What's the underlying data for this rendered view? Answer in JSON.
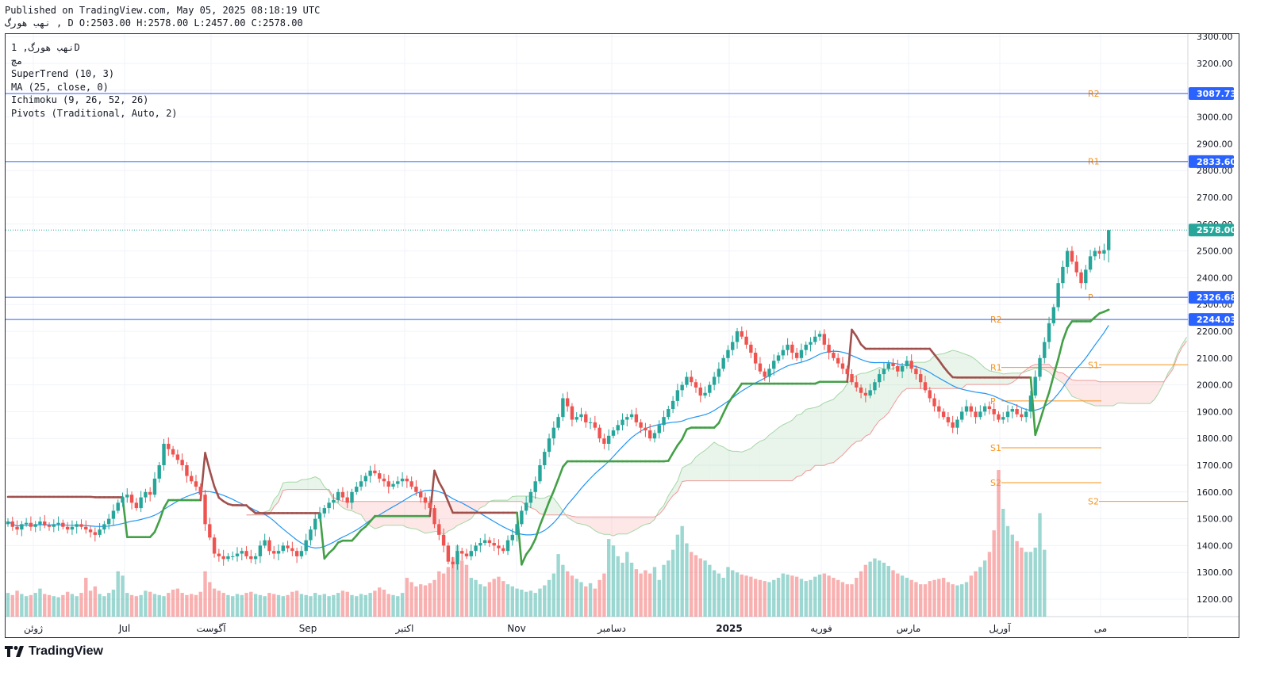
{
  "header": {
    "published": "Published on TradingView.com, May 05, 2025 08:18:19 UTC",
    "ohlc": "نهب هورگ ,  D O:2503.00 H:2578.00 L:2457.00 C:2578.00"
  },
  "legend": {
    "symbol": "نهب هورگ, 1D",
    "exchange": "مچ",
    "indicators": [
      "SuperTrend (10, 3)",
      "MA (25, close, 0)",
      "Ichimoku (9, 26, 52, 26)",
      "Pivots (Traditional, Auto, 2)"
    ]
  },
  "brand": {
    "logo_text": "TradingView"
  },
  "colors": {
    "up": "#26a69a",
    "down": "#ef5350",
    "supertrend_up": "#43a047",
    "supertrend_down": "#a0504c",
    "ma": "#2196f3",
    "pivot": "#f7931a",
    "hline": "#2962ff",
    "last_price": "#26a69a"
  },
  "chart_data": {
    "type": "candlestick",
    "symbol": "نهب هورگ",
    "interval": "1D",
    "ohlc_last": {
      "open": 2503,
      "high": 2578,
      "low": 2457,
      "close": 2578
    },
    "y_axis": {
      "ticks": [
        1200,
        1300,
        1400,
        1500,
        1600,
        1700,
        1800,
        1900,
        2000,
        2100,
        2200,
        2300,
        2400,
        2500,
        2600,
        2700,
        2800,
        2900,
        3000,
        3100,
        3200,
        3300
      ],
      "ylim": [
        1085,
        3340
      ]
    },
    "x_axis": {
      "labels": [
        "ژوئن",
        "Jul",
        "آگوست",
        "Sep",
        "اکتبر",
        "Nov",
        "دسامبر",
        "2025",
        "فوریه",
        "مارس",
        "آوریل",
        "می"
      ]
    },
    "price_labels": [
      {
        "value": 3087.73,
        "text": "3087.73",
        "kind": "line"
      },
      {
        "value": 2833.6,
        "text": "2833.60",
        "kind": "line"
      },
      {
        "value": 2578.0,
        "text": "2578.00",
        "kind": "last"
      },
      {
        "value": 2326.68,
        "text": "2326.68",
        "kind": "line"
      },
      {
        "value": 2244.03,
        "text": "2244.03",
        "kind": "line"
      }
    ],
    "horizontal_lines": [
      3087.73,
      2833.6,
      2326.68,
      2244.03
    ],
    "pivot_levels": [
      {
        "label": "R2",
        "value": 2245,
        "period": 1
      },
      {
        "label": "R1",
        "value": 2065,
        "period": 1
      },
      {
        "label": "P",
        "value": 1940,
        "period": 1
      },
      {
        "label": "S1",
        "value": 1765,
        "period": 1
      },
      {
        "label": "S2",
        "value": 1635,
        "period": 1
      },
      {
        "label": "R2",
        "value": 3088,
        "period": 2
      },
      {
        "label": "R1",
        "value": 2834,
        "period": 2
      },
      {
        "label": "P",
        "value": 2327,
        "period": 2
      },
      {
        "label": "S1",
        "value": 2075,
        "period": 2
      },
      {
        "label": "S2",
        "value": 1565,
        "period": 2
      }
    ],
    "closes": [
      1490,
      1470,
      1460,
      1480,
      1485,
      1470,
      1480,
      1490,
      1475,
      1470,
      1480,
      1485,
      1470,
      1460,
      1470,
      1480,
      1470,
      1460,
      1450,
      1440,
      1460,
      1480,
      1500,
      1530,
      1560,
      1580,
      1590,
      1560,
      1540,
      1580,
      1600,
      1590,
      1650,
      1700,
      1780,
      1760,
      1740,
      1720,
      1700,
      1660,
      1640,
      1620,
      1590,
      1480,
      1430,
      1370,
      1360,
      1350,
      1360,
      1360,
      1370,
      1380,
      1360,
      1350,
      1360,
      1400,
      1420,
      1380,
      1370,
      1380,
      1400,
      1390,
      1380,
      1360,
      1380,
      1420,
      1460,
      1500,
      1520,
      1540,
      1560,
      1570,
      1600,
      1580,
      1560,
      1600,
      1620,
      1640,
      1660,
      1680,
      1670,
      1650,
      1640,
      1620,
      1630,
      1640,
      1650,
      1640,
      1620,
      1600,
      1580,
      1560,
      1540,
      1480,
      1440,
      1400,
      1340,
      1330,
      1380,
      1370,
      1360,
      1380,
      1400,
      1410,
      1420,
      1410,
      1400,
      1390,
      1380,
      1420,
      1440,
      1480,
      1530,
      1560,
      1600,
      1640,
      1700,
      1750,
      1800,
      1840,
      1880,
      1950,
      1920,
      1870,
      1880,
      1890,
      1860,
      1860,
      1840,
      1800,
      1780,
      1810,
      1830,
      1850,
      1870,
      1880,
      1890,
      1860,
      1840,
      1830,
      1800,
      1820,
      1850,
      1880,
      1910,
      1940,
      1980,
      2000,
      2030,
      2010,
      1990,
      1960,
      1970,
      2000,
      2030,
      2060,
      2100,
      2130,
      2160,
      2200,
      2180,
      2150,
      2120,
      2080,
      2050,
      2030,
      2060,
      2090,
      2110,
      2130,
      2150,
      2120,
      2100,
      2130,
      2150,
      2160,
      2180,
      2190,
      2150,
      2120,
      2100,
      2080,
      2060,
      2040,
      2010,
      1990,
      1970,
      1960,
      1980,
      2010,
      2040,
      2060,
      2080,
      2070,
      2050,
      2070,
      2090,
      2060,
      2040,
      2010,
      1980,
      1950,
      1920,
      1900,
      1880,
      1860,
      1840,
      1870,
      1900,
      1920,
      1900,
      1880,
      1900,
      1920,
      1910,
      1890,
      1870,
      1880,
      1900,
      1910,
      1890,
      1880,
      1900,
      1960,
      2030,
      2100,
      2160,
      2230,
      2290,
      2380,
      2440,
      2500,
      2460,
      2420,
      2380,
      2430,
      2480,
      2500,
      2490,
      2503,
      2578
    ],
    "volumes": [
      110,
      100,
      120,
      105,
      95,
      100,
      110,
      130,
      105,
      100,
      95,
      90,
      100,
      115,
      105,
      95,
      110,
      180,
      120,
      140,
      105,
      95,
      110,
      125,
      210,
      190,
      110,
      100,
      95,
      100,
      120,
      115,
      105,
      100,
      95,
      110,
      125,
      130,
      110,
      100,
      105,
      100,
      115,
      210,
      160,
      130,
      120,
      110,
      100,
      95,
      105,
      100,
      110,
      115,
      105,
      100,
      95,
      110,
      105,
      100,
      95,
      100,
      115,
      120,
      105,
      100,
      95,
      110,
      100,
      105,
      95,
      100,
      110,
      120,
      115,
      100,
      95,
      105,
      100,
      110,
      120,
      135,
      125,
      105,
      100,
      95,
      110,
      180,
      160,
      140,
      150,
      145,
      155,
      170,
      210,
      200,
      230,
      275,
      330,
      260,
      240,
      180,
      170,
      150,
      140,
      160,
      175,
      185,
      165,
      150,
      140,
      130,
      125,
      115,
      120,
      110,
      130,
      145,
      170,
      200,
      290,
      240,
      210,
      190,
      175,
      160,
      140,
      155,
      130,
      170,
      200,
      360,
      330,
      280,
      250,
      300,
      250,
      220,
      200,
      215,
      200,
      230,
      170,
      240,
      260,
      310,
      380,
      420,
      340,
      300,
      285,
      270,
      260,
      240,
      215,
      200,
      180,
      230,
      215,
      205,
      195,
      190,
      185,
      175,
      170,
      165,
      160,
      170,
      180,
      200,
      195,
      190,
      185,
      175,
      165,
      170,
      185,
      195,
      200,
      190,
      180,
      170,
      160,
      150,
      150,
      180,
      210,
      240,
      255,
      270,
      260,
      250,
      235,
      215,
      200,
      190,
      180,
      170,
      160,
      150,
      150,
      165,
      170,
      175,
      180,
      160,
      150,
      145,
      150,
      160,
      190,
      210,
      230,
      260,
      300,
      400,
      680,
      500,
      420,
      380,
      350,
      320,
      300,
      300,
      320,
      480,
      310
    ]
  }
}
